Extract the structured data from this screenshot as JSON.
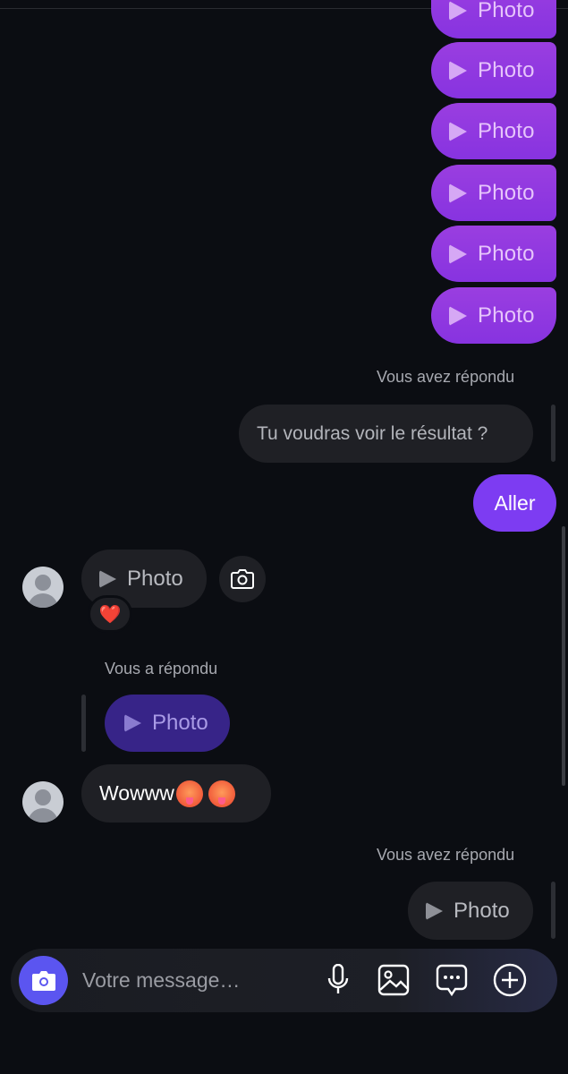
{
  "thread": {
    "sent_photo_label": "Photo",
    "sent_photos_count_visible": 6,
    "reply_meta_1": "Vous avez répondu",
    "quoted_message": "Tu voudras voir le résultat ?",
    "sent_text": "Aller",
    "received_photo_label": "Photo",
    "reaction": "❤️",
    "reply_meta_2": "Vous a répondu",
    "quoted_photo_label": "Photo",
    "received_text": "Wowww",
    "reply_meta_3": "Vous avez répondu",
    "last_quoted_photo_label": "Photo"
  },
  "composer": {
    "placeholder": "Votre message…"
  },
  "colors": {
    "background": "#0b0d12",
    "sent_bubble": "#8733e0",
    "sent_text_bubble": "#7d3cf2",
    "received_bubble": "#1f2025",
    "camera_button": "#5b55f0"
  },
  "icons": {
    "camera": "camera-icon",
    "mic": "microphone-icon",
    "gallery": "image-icon",
    "chat": "chat-bubble-icon",
    "add": "plus-circle-icon"
  }
}
